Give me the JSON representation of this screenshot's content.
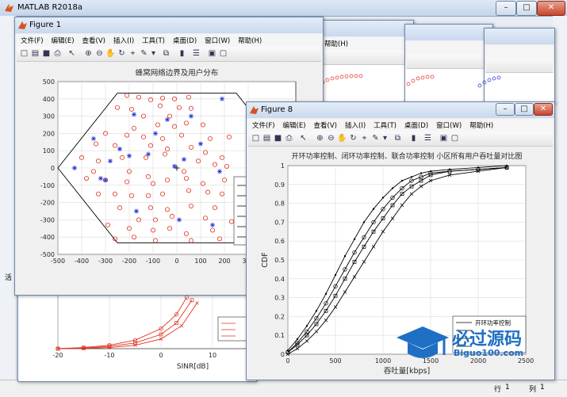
{
  "app": {
    "title": "MATLAB R2018a"
  },
  "status": {
    "row_label": "行",
    "row_value": "1",
    "col_label": "列",
    "col_value": "1"
  },
  "menus": [
    "文件(F)",
    "编辑(E)",
    "查看(V)",
    "插入(I)",
    "工具(T)",
    "桌面(D)",
    "窗口(W)",
    "帮助(H)"
  ],
  "background_menu_fragment": "帮助(H)",
  "side_fragment": "活",
  "figure1": {
    "title": "Figure 1",
    "chart_data": {
      "type": "scatter",
      "title": "蜂窝网络边界及用户分布",
      "xlim": [
        -500,
        500
      ],
      "ylim": [
        -500,
        500
      ],
      "xticks": [
        -500,
        -400,
        -300,
        -200,
        -100,
        0,
        100,
        200,
        300
      ],
      "yticks": [
        500,
        400,
        300,
        200,
        100,
        0,
        -100,
        -200,
        -300,
        -400,
        -500
      ],
      "grid": true,
      "hexagon": [
        [
          -500,
          0
        ],
        [
          -250,
          433
        ],
        [
          250,
          433
        ],
        [
          500,
          0
        ],
        [
          250,
          -433
        ],
        [
          -250,
          -433
        ]
      ],
      "base_station": [
        0,
        0
      ],
      "users_circle": [
        [
          -210,
          420
        ],
        [
          -160,
          410
        ],
        [
          -110,
          395
        ],
        [
          -60,
          405
        ],
        [
          -10,
          400
        ],
        [
          50,
          410
        ],
        [
          -250,
          350
        ],
        [
          -190,
          340
        ],
        [
          -70,
          360
        ],
        [
          10,
          350
        ],
        [
          60,
          345
        ],
        [
          -140,
          300
        ],
        [
          -30,
          300
        ],
        [
          40,
          260
        ],
        [
          -180,
          230
        ],
        [
          -80,
          250
        ],
        [
          -10,
          240
        ],
        [
          -300,
          200
        ],
        [
          -210,
          190
        ],
        [
          -140,
          180
        ],
        [
          -60,
          170
        ],
        [
          20,
          190
        ],
        [
          110,
          250
        ],
        [
          140,
          170
        ],
        [
          220,
          180
        ],
        [
          -340,
          140
        ],
        [
          -260,
          130
        ],
        [
          -110,
          130
        ],
        [
          -40,
          110
        ],
        [
          60,
          120
        ],
        [
          120,
          90
        ],
        [
          190,
          60
        ],
        [
          -400,
          60
        ],
        [
          -330,
          40
        ],
        [
          -230,
          60
        ],
        [
          -130,
          60
        ],
        [
          -50,
          80
        ],
        [
          90,
          40
        ],
        [
          160,
          20
        ],
        [
          210,
          10
        ],
        [
          -380,
          -60
        ],
        [
          -300,
          -70
        ],
        [
          -210,
          -80
        ],
        [
          -100,
          -90
        ],
        [
          -40,
          -70
        ],
        [
          40,
          -60
        ],
        [
          110,
          -90
        ],
        [
          200,
          -70
        ],
        [
          -330,
          -150
        ],
        [
          -260,
          -150
        ],
        [
          -190,
          -160
        ],
        [
          -120,
          -160
        ],
        [
          -60,
          -150
        ],
        [
          50,
          -130
        ],
        [
          130,
          -140
        ],
        [
          190,
          -150
        ],
        [
          -240,
          -230
        ],
        [
          -110,
          -230
        ],
        [
          -40,
          -240
        ],
        [
          60,
          -220
        ],
        [
          160,
          -230
        ],
        [
          -160,
          -300
        ],
        [
          -90,
          -300
        ],
        [
          -20,
          -280
        ],
        [
          120,
          -290
        ],
        [
          -290,
          -330
        ],
        [
          -200,
          -350
        ],
        [
          -100,
          -360
        ],
        [
          -30,
          -350
        ],
        [
          40,
          -380
        ],
        [
          150,
          -360
        ],
        [
          -260,
          -410
        ],
        [
          -180,
          -400
        ],
        [
          -90,
          -420
        ],
        [
          60,
          -420
        ],
        [
          180,
          -410
        ],
        [
          230,
          -310
        ],
        [
          -120,
          -50
        ],
        [
          30,
          -20
        ],
        [
          -200,
          -20
        ],
        [
          -350,
          -20
        ]
      ],
      "users_star": [
        [
          190,
          400
        ],
        [
          -180,
          310
        ],
        [
          -40,
          280
        ],
        [
          60,
          300
        ],
        [
          -350,
          170
        ],
        [
          -240,
          110
        ],
        [
          -280,
          40
        ],
        [
          -430,
          0
        ],
        [
          -320,
          -60
        ],
        [
          -300,
          -70
        ],
        [
          -170,
          -250
        ],
        [
          10,
          -300
        ],
        [
          150,
          -330
        ],
        [
          -120,
          80
        ],
        [
          30,
          50
        ],
        [
          180,
          -20
        ],
        [
          -200,
          70
        ],
        [
          -90,
          200
        ],
        [
          100,
          140
        ],
        [
          -10,
          10
        ]
      ]
    }
  },
  "figure8": {
    "title": "Figure 8",
    "chart_data": {
      "type": "line",
      "title": "开环功率控制、闭环功率控制、联合功率控制 小区所有用户吞吐量对比图",
      "xlabel": "吞吐量[kbps]",
      "ylabel": "CDF",
      "xlim": [
        0,
        2500
      ],
      "ylim": [
        0,
        1
      ],
      "xticks": [
        0,
        500,
        1000,
        1500,
        2000,
        2500
      ],
      "yticks": [
        0,
        0.1,
        0.2,
        0.3,
        0.4,
        0.5,
        0.6,
        0.7,
        0.8,
        0.9,
        1
      ],
      "grid": true,
      "series": [
        {
          "name": "开环功率控制",
          "marker": "dot",
          "points": [
            [
              0,
              0.02
            ],
            [
              100,
              0.08
            ],
            [
              200,
              0.15
            ],
            [
              300,
              0.23
            ],
            [
              400,
              0.32
            ],
            [
              500,
              0.42
            ],
            [
              600,
              0.52
            ],
            [
              700,
              0.61
            ],
            [
              800,
              0.7
            ],
            [
              900,
              0.77
            ],
            [
              1000,
              0.83
            ],
            [
              1100,
              0.88
            ],
            [
              1200,
              0.92
            ],
            [
              1300,
              0.94
            ],
            [
              1400,
              0.96
            ],
            [
              1500,
              0.97
            ],
            [
              1700,
              0.98
            ],
            [
              2000,
              0.99
            ],
            [
              2300,
              1.0
            ]
          ]
        },
        {
          "name": "",
          "marker": "circle",
          "points": [
            [
              0,
              0.01
            ],
            [
              100,
              0.06
            ],
            [
              200,
              0.12
            ],
            [
              300,
              0.19
            ],
            [
              400,
              0.27
            ],
            [
              500,
              0.36
            ],
            [
              600,
              0.45
            ],
            [
              700,
              0.54
            ],
            [
              800,
              0.62
            ],
            [
              900,
              0.7
            ],
            [
              1000,
              0.77
            ],
            [
              1100,
              0.83
            ],
            [
              1200,
              0.88
            ],
            [
              1300,
              0.92
            ],
            [
              1400,
              0.94
            ],
            [
              1500,
              0.96
            ],
            [
              1700,
              0.97
            ],
            [
              2000,
              0.98
            ],
            [
              2300,
              0.99
            ]
          ]
        },
        {
          "name": "",
          "marker": "square",
          "points": [
            [
              0,
              0.01
            ],
            [
              100,
              0.05
            ],
            [
              200,
              0.1
            ],
            [
              300,
              0.16
            ],
            [
              400,
              0.23
            ],
            [
              500,
              0.31
            ],
            [
              600,
              0.4
            ],
            [
              700,
              0.49
            ],
            [
              800,
              0.57
            ],
            [
              900,
              0.65
            ],
            [
              1000,
              0.72
            ],
            [
              1100,
              0.79
            ],
            [
              1200,
              0.85
            ],
            [
              1300,
              0.89
            ],
            [
              1400,
              0.92
            ],
            [
              1500,
              0.95
            ],
            [
              1700,
              0.97
            ],
            [
              2000,
              0.98
            ],
            [
              2300,
              0.99
            ]
          ]
        },
        {
          "name": "",
          "marker": "x",
          "points": [
            [
              0,
              0.0
            ],
            [
              100,
              0.03
            ],
            [
              200,
              0.07
            ],
            [
              300,
              0.12
            ],
            [
              400,
              0.18
            ],
            [
              500,
              0.25
            ],
            [
              600,
              0.33
            ],
            [
              700,
              0.41
            ],
            [
              800,
              0.49
            ],
            [
              900,
              0.57
            ],
            [
              1000,
              0.65
            ],
            [
              1100,
              0.72
            ],
            [
              1200,
              0.79
            ],
            [
              1300,
              0.85
            ],
            [
              1400,
              0.89
            ],
            [
              1500,
              0.92
            ],
            [
              1700,
              0.95
            ],
            [
              2000,
              0.97
            ],
            [
              2300,
              0.99
            ]
          ]
        }
      ]
    }
  },
  "bg_plot": {
    "chart_data": {
      "type": "line",
      "xlabel": "SINR[dB]",
      "xlim": [
        -20,
        20
      ],
      "xticks": [
        -20,
        -10,
        0,
        10
      ],
      "series": [
        {
          "name": "",
          "marker": "circle",
          "points": [
            [
              -20,
              0.0
            ],
            [
              -15,
              0.02
            ],
            [
              -10,
              0.06
            ],
            [
              -5,
              0.15
            ],
            [
              0,
              0.35
            ],
            [
              3,
              0.6
            ],
            [
              5,
              0.9
            ]
          ]
        },
        {
          "name": "",
          "marker": "square",
          "points": [
            [
              -20,
              0.0
            ],
            [
              -15,
              0.01
            ],
            [
              -10,
              0.04
            ],
            [
              -5,
              0.1
            ],
            [
              0,
              0.25
            ],
            [
              3,
              0.45
            ],
            [
              6,
              0.85
            ]
          ]
        },
        {
          "name": "",
          "marker": "x",
          "points": [
            [
              -20,
              0.0
            ],
            [
              -15,
              0.005
            ],
            [
              -10,
              0.02
            ],
            [
              -5,
              0.06
            ],
            [
              0,
              0.17
            ],
            [
              4,
              0.4
            ],
            [
              7,
              0.8
            ]
          ]
        }
      ]
    }
  },
  "watermark": {
    "main": "必过源码",
    "sub": "Biguo100.com"
  }
}
